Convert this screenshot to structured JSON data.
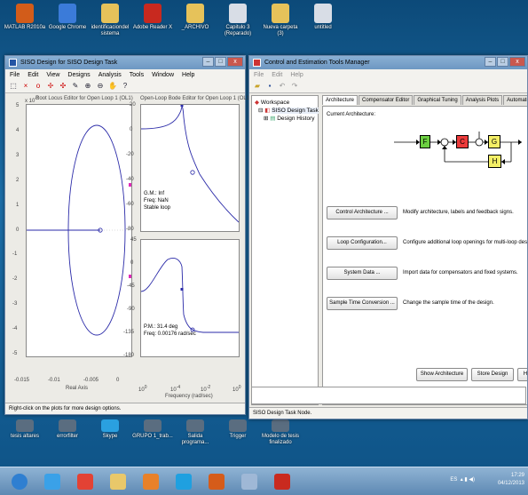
{
  "desktop_top_icons": [
    {
      "label": "MATLAB R2010a",
      "color": "#d25c1a"
    },
    {
      "label": "Google Chrome",
      "color": "#3b7bd9"
    },
    {
      "label": "identificaciondel sistema",
      "color": "#e6c25a"
    },
    {
      "label": "Adobe Reader X",
      "color": "#c8291f"
    },
    {
      "label": "_ARCHIVO",
      "color": "#e6c25a"
    },
    {
      "label": "Capitulo 3 (Reparado)",
      "color": "#d8dde6"
    },
    {
      "label": "Nueva carpeta (3)",
      "color": "#e6c25a"
    },
    {
      "label": "untitled",
      "color": "#d8dde6"
    }
  ],
  "desktop_bottom_icons": [
    {
      "label": "tesis altares",
      "color": "#5a6d80"
    },
    {
      "label": "errorfilter",
      "color": "#5a6d80"
    },
    {
      "label": "Skype",
      "color": "#2aa0e0"
    },
    {
      "label": "GRUPO 1_trab...",
      "color": "#5a6d80"
    },
    {
      "label": "Salida programa...",
      "color": "#5a6d80"
    },
    {
      "label": "Trigger",
      "color": "#5a6d80"
    },
    {
      "label": "Modelo de tesis finalizado",
      "color": "#5a6d80"
    }
  ],
  "siso": {
    "title": "SISO Design for SISO Design Task",
    "menu": [
      "File",
      "Edit",
      "View",
      "Designs",
      "Analysis",
      "Tools",
      "Window",
      "Help"
    ],
    "root_locus": {
      "title": "Root Locus Editor for Open Loop 1 (OL1)",
      "exp": "x 10",
      "xlabel": "Real Axis",
      "xticks": [
        "-0.015",
        "-0.01",
        "-0.005",
        "0"
      ],
      "yticks": [
        "5",
        "4",
        "3",
        "2",
        "1",
        "0",
        "-1",
        "-2",
        "-3",
        "-4",
        "-5"
      ]
    },
    "bode": {
      "title": "Open-Loop Bode Editor for Open Loop 1 (OL1)",
      "mag_ticks": [
        "20",
        "0",
        "-20",
        "-40",
        "-60",
        "-80"
      ],
      "phase_ticks": [
        "45",
        "0",
        "-45",
        "-90",
        "-135",
        "-180"
      ],
      "gm_lines": [
        "G.M.: Inf",
        "Freq: NaN",
        "Stable loop"
      ],
      "pm_lines": [
        "P.M.: 31.4 deg",
        "Freq: 0.00176 rad/sec"
      ],
      "xticks": [
        "10",
        "10",
        "10",
        "10"
      ],
      "xexps": [
        "0",
        "-4",
        "-2",
        "0"
      ],
      "xlabel": "Frequency (rad/sec)"
    },
    "status": "Right-click on the plots for more design options."
  },
  "cetm": {
    "title": "Control and Estimation Tools Manager",
    "menu": [
      "File",
      "Edit",
      "Help"
    ],
    "tree": [
      "Workspace",
      "SISO Design Task",
      "Design History"
    ],
    "tabs": [
      "Architecture",
      "Compensator Editor",
      "Graphical Tuning",
      "Analysis Plots",
      "Automated Tuning"
    ],
    "current_architecture_label": "Current Architecture:",
    "blocks": {
      "F": "F",
      "C": "C",
      "G": "G",
      "H": "H"
    },
    "rows": [
      {
        "button": "Control Architecture ...",
        "desc": "Modify architecture, labels and feedback signs."
      },
      {
        "button": "Loop Configuration...",
        "desc": "Configure additional loop openings for multi-loop design."
      },
      {
        "button": "System Data ...",
        "desc": "Import data for compensators and fixed systems."
      },
      {
        "button": "Sample Time Conversion ...",
        "desc": "Change the sample time of the design."
      }
    ],
    "footer_buttons": [
      "Show Architecture",
      "Store Design",
      "Help"
    ],
    "status": "SISO Design Task Node."
  },
  "taskbar": {
    "apps": [
      {
        "name": "windows-start",
        "color": "#2f7fd1"
      },
      {
        "name": "internet-explorer",
        "color": "#3aa1e8"
      },
      {
        "name": "chrome",
        "color": "#e34234"
      },
      {
        "name": "file-explorer",
        "color": "#e9c86a"
      },
      {
        "name": "media-player",
        "color": "#e8812a"
      },
      {
        "name": "skype",
        "color": "#1fa0e0"
      },
      {
        "name": "matlab",
        "color": "#d55c1a"
      },
      {
        "name": "notepad",
        "color": "#9fb8d6"
      },
      {
        "name": "adobe-reader",
        "color": "#c92a1f"
      }
    ],
    "language": "ES",
    "time": "17:29",
    "date": "04/12/2013"
  }
}
